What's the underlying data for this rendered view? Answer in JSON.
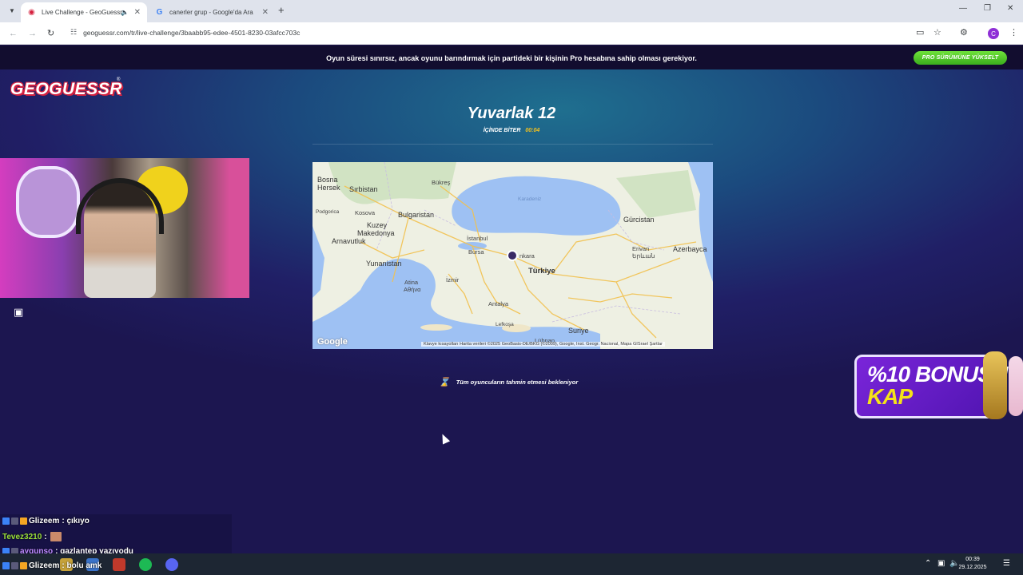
{
  "browser": {
    "tabs": [
      {
        "title": "Live Challenge - GeoGuessr",
        "active": true,
        "favicon": "geoguessr-pin-icon",
        "audio": true
      },
      {
        "title": "canerler grup - Google'da Ara",
        "active": false,
        "favicon": "google-g-icon"
      }
    ],
    "new_tab": "+",
    "url": "geoguessr.com/tr/live-challenge/3baabb95-edee-4501-8230-03afcc703c",
    "avatar_letter": "C"
  },
  "banner": {
    "text": "Oyun süresi sınırsız, ancak oyunu barındırmak için partideki bir kişinin Pro hesabına sahip olması gerekiyor.",
    "upgrade_button": "PRO SÜRÜMÜNE YÜKSELT"
  },
  "logo": {
    "text": "GEOGUESSR",
    "reg": "®"
  },
  "round": {
    "title": "Yuvarlak 12",
    "ends_label": "İÇİNDE BİTER",
    "time": "00:04"
  },
  "map": {
    "labels": {
      "bosna": "Bosna",
      "hersek": "Hersek",
      "sirbistan": "Sırbistan",
      "bukres": "Bükreş",
      "karadeniz": "Karadeniz",
      "podgorica": "Podgorica",
      "kosova": "Kosova",
      "bulgaristan": "Bulgaristan",
      "kuzey": "Kuzey",
      "makedonya": "Makedonya",
      "arnavutluk": "Arnavutluk",
      "istanbul": "İstanbul",
      "bursa": "Bursa",
      "ankara": "nkara",
      "turkiye": "Türkiye",
      "yunanistan": "Yunanistan",
      "atina": "Atina",
      "atina_gr": "Αθήνα",
      "izmir": "İzmir",
      "antalya": "Antalya",
      "lefkosa": "Lefkoşa",
      "lubnan": "Lübnan",
      "suriye": "Suriye",
      "gurcistan": "Gürcistan",
      "erivan": "Erivan",
      "erivan_hy": "Երևան",
      "azerbaycan": "Azerbayca"
    },
    "google": "Google",
    "attribution": "Klavye kısayolları    Harita verileri ©2025 GeoBasis-DE/BKG (©2009), Google, Inst. Geogr. Nacional, Mapa GISrael    Şartlar"
  },
  "waiting_text": "Tüm oyuncuların tahmin etmesi bekleniyor",
  "bonus_ad": {
    "line1": "%10 BONUSU",
    "line2": "KAP"
  },
  "chat": [
    {
      "user": "Glizeem",
      "message": ": çıkıyo",
      "color": "#ffffff"
    },
    {
      "user": "Tevez3210",
      "message": ":",
      "color": "#9be03a"
    },
    {
      "user": "aygunso",
      "message": ": gazlantep yazıyodu",
      "color": "#c08cff"
    },
    {
      "user": "Glizeem",
      "message": ": bolu amk",
      "color": "#ffffff"
    }
  ],
  "taskbar": {
    "time": "00:39",
    "date": "29.12.2025"
  },
  "colors": {
    "accent_green": "#4cc227",
    "timer_yellow": "#f7c21b",
    "logo_red": "#d5213f",
    "bonus_purple": "#6a1fd0"
  }
}
